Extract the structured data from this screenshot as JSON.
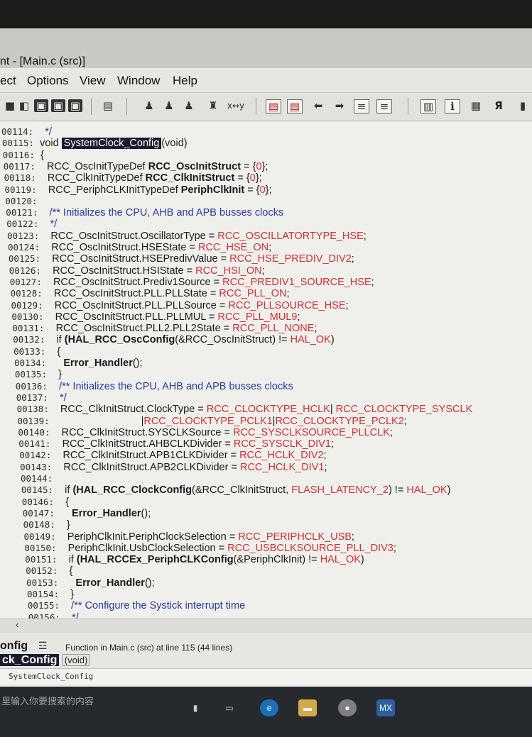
{
  "window": {
    "title": "nt - [Main.c (src)]"
  },
  "menu": [
    "ect",
    "Options",
    "View",
    "Window",
    "Help"
  ],
  "toolbar": {
    "swap_label": "x↔y"
  },
  "code": [
    {
      "num": "00114:",
      "segs": [
        {
          "t": "  */",
          "c": "blue"
        }
      ]
    },
    {
      "num": "00115:",
      "segs": [
        {
          "t": "void ",
          "c": "kw"
        },
        {
          "t": "SystemClock_Config",
          "c": "hl"
        },
        {
          "t": "(void)",
          "c": "kw"
        }
      ]
    },
    {
      "num": "00116:",
      "segs": [
        {
          "t": "{",
          "c": ""
        }
      ]
    },
    {
      "num": "00117:",
      "segs": [
        {
          "t": "  RCC_OscInitTypeDef ",
          "c": ""
        },
        {
          "t": "RCC_OscInitStruct",
          "c": "bold"
        },
        {
          "t": " = {",
          "c": ""
        },
        {
          "t": "0",
          "c": "red"
        },
        {
          "t": "};",
          "c": ""
        }
      ]
    },
    {
      "num": "00118:",
      "segs": [
        {
          "t": "  RCC_ClkInitTypeDef ",
          "c": ""
        },
        {
          "t": "RCC_ClkInitStruct",
          "c": "bold"
        },
        {
          "t": " = {",
          "c": ""
        },
        {
          "t": "0",
          "c": "red"
        },
        {
          "t": "};",
          "c": ""
        }
      ]
    },
    {
      "num": "00119:",
      "segs": [
        {
          "t": "  RCC_PeriphCLKInitTypeDef ",
          "c": ""
        },
        {
          "t": "PeriphClkInit",
          "c": "bold"
        },
        {
          "t": " = {",
          "c": ""
        },
        {
          "t": "0",
          "c": "red"
        },
        {
          "t": "};",
          "c": ""
        }
      ]
    },
    {
      "num": "00120:",
      "segs": []
    },
    {
      "num": "00121:",
      "segs": [
        {
          "t": "  /** Initializes the CPU, AHB and APB busses clocks",
          "c": "blue"
        }
      ]
    },
    {
      "num": "00122:",
      "segs": [
        {
          "t": "  */",
          "c": "blue"
        }
      ]
    },
    {
      "num": "00123:",
      "segs": [
        {
          "t": "  RCC_OscInitStruct.OscillatorType = ",
          "c": ""
        },
        {
          "t": "RCC_OSCILLATORTYPE_HSE",
          "c": "red"
        },
        {
          "t": ";",
          "c": ""
        }
      ]
    },
    {
      "num": "00124:",
      "segs": [
        {
          "t": "  RCC_OscInitStruct.HSEState = ",
          "c": ""
        },
        {
          "t": "RCC_HSE_ON",
          "c": "red"
        },
        {
          "t": ";",
          "c": ""
        }
      ]
    },
    {
      "num": "00125:",
      "segs": [
        {
          "t": "  RCC_OscInitStruct.HSEPredivValue = ",
          "c": ""
        },
        {
          "t": "RCC_HSE_PREDIV_DIV2",
          "c": "red"
        },
        {
          "t": ";",
          "c": ""
        }
      ]
    },
    {
      "num": "00126:",
      "segs": [
        {
          "t": "  RCC_OscInitStruct.HSIState = ",
          "c": ""
        },
        {
          "t": "RCC_HSI_ON",
          "c": "red"
        },
        {
          "t": ";",
          "c": ""
        }
      ]
    },
    {
      "num": "00127:",
      "segs": [
        {
          "t": "  RCC_OscInitStruct.Prediv1Source = ",
          "c": ""
        },
        {
          "t": "RCC_PREDIV1_SOURCE_HSE",
          "c": "red"
        },
        {
          "t": ";",
          "c": ""
        }
      ]
    },
    {
      "num": "00128:",
      "segs": [
        {
          "t": "  RCC_OscInitStruct.PLL.PLLState = ",
          "c": ""
        },
        {
          "t": "RCC_PLL_ON",
          "c": "red"
        },
        {
          "t": ";",
          "c": ""
        }
      ]
    },
    {
      "num": "00129:",
      "segs": [
        {
          "t": "  RCC_OscInitStruct.PLL.PLLSource = ",
          "c": ""
        },
        {
          "t": "RCC_PLLSOURCE_HSE",
          "c": "red"
        },
        {
          "t": ";",
          "c": ""
        }
      ]
    },
    {
      "num": "00130:",
      "segs": [
        {
          "t": "  RCC_OscInitStruct.PLL.PLLMUL = ",
          "c": ""
        },
        {
          "t": "RCC_PLL_MUL9",
          "c": "red"
        },
        {
          "t": ";",
          "c": ""
        }
      ]
    },
    {
      "num": "00131:",
      "segs": [
        {
          "t": "  RCC_OscInitStruct.PLL2.PLL2State = ",
          "c": ""
        },
        {
          "t": "RCC_PLL_NONE",
          "c": "red"
        },
        {
          "t": ";",
          "c": ""
        }
      ]
    },
    {
      "num": "00132:",
      "segs": [
        {
          "t": "  if ",
          "c": "kw"
        },
        {
          "t": "(HAL_RCC_OscConfig",
          "c": "bold"
        },
        {
          "t": "(&RCC_OscInitStruct) != ",
          "c": ""
        },
        {
          "t": "HAL_OK",
          "c": "red"
        },
        {
          "t": ")",
          "c": ""
        }
      ]
    },
    {
      "num": "00133:",
      "segs": [
        {
          "t": "  {",
          "c": ""
        }
      ]
    },
    {
      "num": "00134:",
      "segs": [
        {
          "t": "    Error_Handler",
          "c": "bold"
        },
        {
          "t": "();",
          "c": ""
        }
      ]
    },
    {
      "num": "00135:",
      "segs": [
        {
          "t": "  }",
          "c": ""
        }
      ]
    },
    {
      "num": "00136:",
      "segs": [
        {
          "t": "  /** Initializes the CPU, AHB and APB busses clocks",
          "c": "blue"
        }
      ]
    },
    {
      "num": "00137:",
      "segs": [
        {
          "t": "  */",
          "c": "blue"
        }
      ]
    },
    {
      "num": "00138:",
      "segs": [
        {
          "t": "  RCC_ClkInitStruct.ClockType = ",
          "c": ""
        },
        {
          "t": "RCC_CLOCKTYPE_HCLK",
          "c": "red"
        },
        {
          "t": "| ",
          "c": ""
        },
        {
          "t": "RCC_CLOCKTYPE_SYSCLK",
          "c": "red"
        }
      ]
    },
    {
      "num": "00139:",
      "segs": [
        {
          "t": "                              |",
          "c": ""
        },
        {
          "t": "RCC_CLOCKTYPE_PCLK1",
          "c": "red"
        },
        {
          "t": "|",
          "c": ""
        },
        {
          "t": "RCC_CLOCKTYPE_PCLK2",
          "c": "red"
        },
        {
          "t": ";",
          "c": ""
        }
      ]
    },
    {
      "num": "00140:",
      "segs": [
        {
          "t": "  RCC_ClkInitStruct.SYSCLKSource = ",
          "c": ""
        },
        {
          "t": "RCC_SYSCLKSOURCE_PLLCLK",
          "c": "red"
        },
        {
          "t": ";",
          "c": ""
        }
      ]
    },
    {
      "num": "00141:",
      "segs": [
        {
          "t": "  RCC_ClkInitStruct.AHBCLKDivider = ",
          "c": ""
        },
        {
          "t": "RCC_SYSCLK_DIV1",
          "c": "red"
        },
        {
          "t": ";",
          "c": ""
        }
      ]
    },
    {
      "num": "00142:",
      "segs": [
        {
          "t": "  RCC_ClkInitStruct.APB1CLKDivider = ",
          "c": ""
        },
        {
          "t": "RCC_HCLK_DIV2",
          "c": "red"
        },
        {
          "t": ";",
          "c": ""
        }
      ]
    },
    {
      "num": "00143:",
      "segs": [
        {
          "t": "  RCC_ClkInitStruct.APB2CLKDivider = ",
          "c": ""
        },
        {
          "t": "RCC_HCLK_DIV1",
          "c": "red"
        },
        {
          "t": ";",
          "c": ""
        }
      ]
    },
    {
      "num": "00144:",
      "segs": []
    },
    {
      "num": "00145:",
      "segs": [
        {
          "t": "  if ",
          "c": "kw"
        },
        {
          "t": "(HAL_RCC_ClockConfig",
          "c": "bold"
        },
        {
          "t": "(&RCC_ClkInitStruct, ",
          "c": ""
        },
        {
          "t": "FLASH_LATENCY_2",
          "c": "red"
        },
        {
          "t": ") != ",
          "c": ""
        },
        {
          "t": "HAL_OK",
          "c": "red"
        },
        {
          "t": ")",
          "c": ""
        }
      ]
    },
    {
      "num": "00146:",
      "segs": [
        {
          "t": "  {",
          "c": ""
        }
      ]
    },
    {
      "num": "00147:",
      "segs": [
        {
          "t": "    Error_Handler",
          "c": "bold"
        },
        {
          "t": "();",
          "c": ""
        }
      ]
    },
    {
      "num": "00148:",
      "segs": [
        {
          "t": "  }",
          "c": ""
        }
      ]
    },
    {
      "num": "00149:",
      "segs": [
        {
          "t": "  PeriphClkInit.PeriphClockSelection = ",
          "c": ""
        },
        {
          "t": "RCC_PERIPHCLK_USB",
          "c": "red"
        },
        {
          "t": ";",
          "c": ""
        }
      ]
    },
    {
      "num": "00150:",
      "segs": [
        {
          "t": "  PeriphClkInit.UsbClockSelection = ",
          "c": ""
        },
        {
          "t": "RCC_USBCLKSOURCE_PLL_DIV3",
          "c": "red"
        },
        {
          "t": ";",
          "c": ""
        }
      ]
    },
    {
      "num": "00151:",
      "segs": [
        {
          "t": "  if ",
          "c": "kw"
        },
        {
          "t": "(HAL_RCCEx_PeriphCLKConfig",
          "c": "bold"
        },
        {
          "t": "(&PeriphClkInit) != ",
          "c": ""
        },
        {
          "t": "HAL_OK",
          "c": "red"
        },
        {
          "t": ")",
          "c": ""
        }
      ]
    },
    {
      "num": "00152:",
      "segs": [
        {
          "t": "  {",
          "c": ""
        }
      ]
    },
    {
      "num": "00153:",
      "segs": [
        {
          "t": "    Error_Handler",
          "c": "bold"
        },
        {
          "t": "();",
          "c": ""
        }
      ]
    },
    {
      "num": "00154:",
      "segs": [
        {
          "t": "  }",
          "c": ""
        }
      ]
    },
    {
      "num": "00155:",
      "segs": [
        {
          "t": "  /** Configure the Systick interrupt time",
          "c": "blue"
        }
      ]
    },
    {
      "num": "00156:",
      "segs": [
        {
          "t": "  */",
          "c": "blue"
        }
      ]
    }
  ],
  "status": {
    "symbol_partial": "onfig",
    "info": "Function in Main.c (src) at line 115 (44 lines)",
    "func_name": "ck_Config",
    "func_args": "(void)",
    "context_name": "SystemClock_Config"
  },
  "taskbar": {
    "search_placeholder": "里输入你要搜索的内容",
    "mx_label": "MX"
  },
  "colors": {
    "keyword_red": "#cf3131",
    "comment_blue": "#2a3a9a",
    "highlight_bg": "#1b1b2e"
  }
}
